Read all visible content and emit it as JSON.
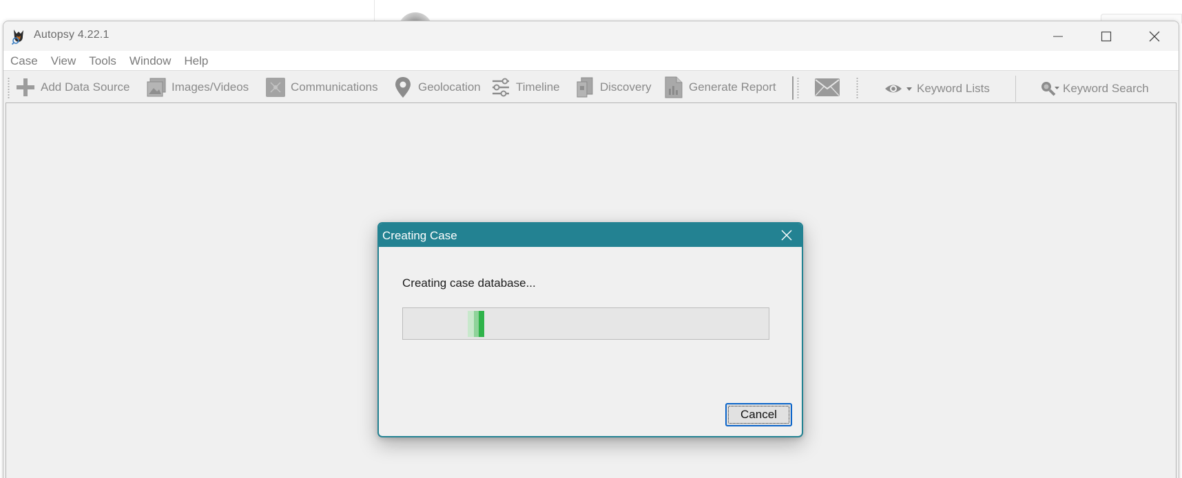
{
  "window": {
    "title": "Autopsy 4.22.1",
    "accent": "#238292"
  },
  "menu": {
    "items": [
      "Case",
      "View",
      "Tools",
      "Window",
      "Help"
    ]
  },
  "toolbar": {
    "add_data_source": "Add Data Source",
    "images_videos": "Images/Videos",
    "communications": "Communications",
    "geolocation": "Geolocation",
    "timeline": "Timeline",
    "discovery": "Discovery",
    "generate_report": "Generate Report",
    "keyword_lists": "Keyword Lists",
    "keyword_search": "Keyword Search",
    "icons": {
      "add_data_source": "plus-icon",
      "images_videos": "images-icon",
      "communications": "communications-icon",
      "geolocation": "map-pin-icon",
      "timeline": "timeline-icon",
      "discovery": "discovery-icon",
      "generate_report": "report-icon",
      "email": "envelope-icon",
      "keyword_lists": "eye-icon",
      "keyword_search": "magnifier-icon"
    }
  },
  "dialog": {
    "title": "Creating Case",
    "message": "Creating case database...",
    "progress_state": "indeterminate",
    "progress_color": "#2fb34a",
    "cancel_label": "Cancel",
    "border_color": "#238292"
  }
}
